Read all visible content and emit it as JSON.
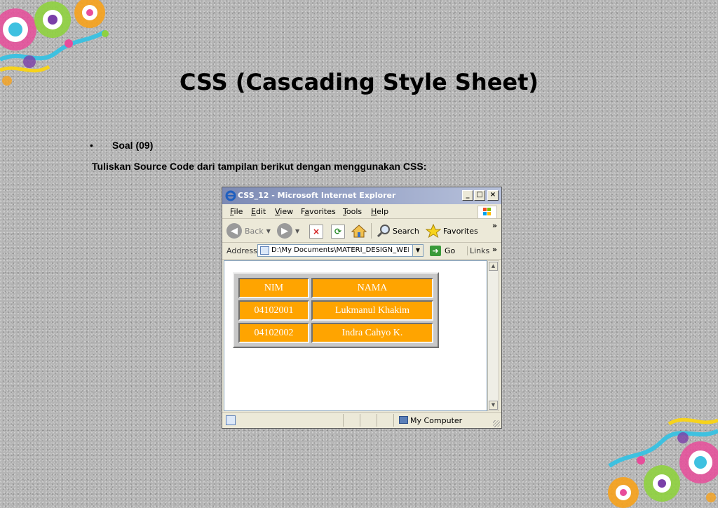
{
  "slide": {
    "title": "CSS (Cascading Style Sheet)",
    "bullet": "Soal (09)",
    "instruction": "Tuliskan Source Code dari tampilan berikut dengan menggunakan CSS:"
  },
  "browser": {
    "window_title": "CSS_12 - Microsoft Internet Explorer",
    "window_buttons": [
      "_",
      "□",
      "×"
    ],
    "menu": {
      "file": {
        "u": "F",
        "rest": "ile"
      },
      "edit": {
        "u": "E",
        "rest": "dit"
      },
      "view": {
        "u": "V",
        "rest": "iew"
      },
      "favorites": {
        "pre": "F",
        "u": "a",
        "rest": "vorites"
      },
      "tools": {
        "u": "T",
        "rest": "ools"
      },
      "help": {
        "u": "H",
        "rest": "elp"
      }
    },
    "toolbar": {
      "back_label": "Back",
      "search_label": "Search",
      "favorites_label": "Favorites",
      "more": "»"
    },
    "address": {
      "label": "Address",
      "value": "D:\\My Documents\\MATERI_DESIGN_WEB\\J",
      "go_label": "Go",
      "links_label": "Links",
      "more": "»"
    },
    "table": {
      "headers": [
        "NIM",
        "NAMA"
      ],
      "rows": [
        [
          "04102001",
          "Lukmanul Khakim"
        ],
        [
          "04102002",
          "Indra Cahyo K."
        ]
      ],
      "cell_color": "#ffa400"
    },
    "status": {
      "zone": "My Computer"
    }
  }
}
